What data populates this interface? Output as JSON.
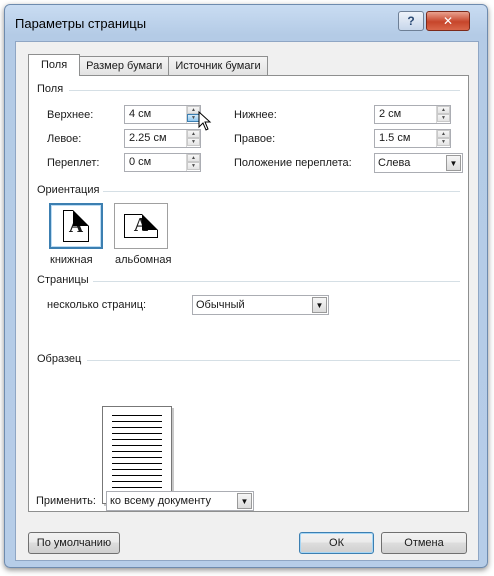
{
  "window": {
    "title": "Параметры страницы",
    "help_glyph": "?",
    "close_glyph": "✕"
  },
  "tabs": [
    "Поля",
    "Размер бумаги",
    "Источник бумаги"
  ],
  "margins_group": {
    "title": "Поля",
    "top_label": "Верхнее:",
    "top_value": "4 см",
    "bottom_label": "Нижнее:",
    "bottom_value": "2 см",
    "left_label": "Левое:",
    "left_value": "2.25 см",
    "right_label": "Правое:",
    "right_value": "1.5 см",
    "gutter_label": "Переплет:",
    "gutter_value": "0 см",
    "gutter_pos_label": "Положение переплета:",
    "gutter_pos_value": "Слева"
  },
  "orientation": {
    "title": "Ориентация",
    "portrait_label": "книжная",
    "landscape_label": "альбомная",
    "icon_letter": "A",
    "selected": "portrait"
  },
  "pages": {
    "title": "Страницы",
    "multiple_label": "несколько страниц:",
    "multiple_value": "Обычный"
  },
  "sample": {
    "title": "Образец"
  },
  "apply": {
    "label": "Применить:",
    "value": "ко всему документу"
  },
  "buttons": {
    "default": "По умолчанию",
    "ok": "ОК",
    "cancel": "Отмена"
  },
  "colors": {
    "accent": "#3c7fb1",
    "window_frame": "#b6cde8",
    "close": "#c7452b"
  }
}
